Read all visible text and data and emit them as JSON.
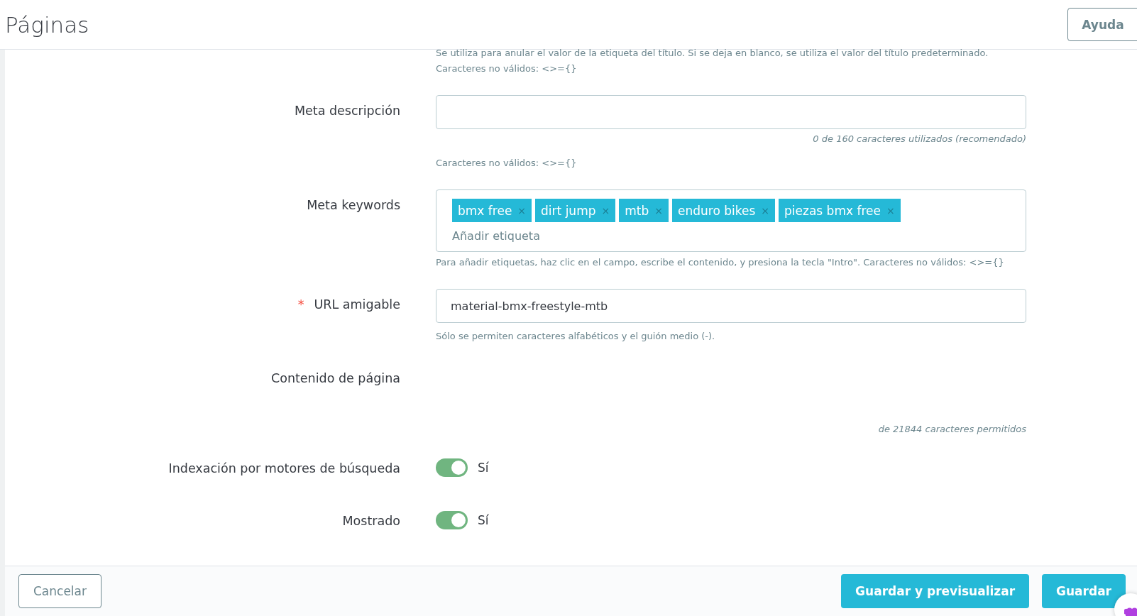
{
  "header": {
    "title": "Páginas",
    "help_button": "Ayuda"
  },
  "top_help": [
    "Se utiliza para anular el valor de la etiqueta del título. Si se deja en blanco, se utiliza el valor del título predeterminado.",
    "Caracteres no válidos: <>={}"
  ],
  "fields": [
    {
      "kind": "text",
      "label": "Meta descripción",
      "counter": "0 de 160 caracteres utilizados (recomendado)",
      "help": "Caracteres no válidos: <>={}"
    },
    {
      "kind": "tags",
      "label": "Meta keywords",
      "tags": [
        "bmx free",
        "dirt jump",
        "mtb",
        "enduro bikes",
        "piezas bmx free"
      ],
      "tag_remove": "×",
      "placeholder": "Añadir etiqueta",
      "help": "Para añadir etiquetas, haz clic en el campo, escribe el contenido, y presiona la tecla \"Intro\". Caracteres no válidos: <>={}"
    },
    {
      "kind": "text",
      "label": "URL amigable",
      "required_mark": "*",
      "value": "material-bmx-freestyle-mtb",
      "help": "Sólo se permiten caracteres alfabéticos y el guión medio (-)."
    },
    {
      "kind": "editor",
      "label": "Contenido de página",
      "counter": "de 21844 caracteres permitidos"
    },
    {
      "kind": "switch",
      "label": "Indexación por motores de búsqueda",
      "on": true,
      "state_label": "Sí"
    },
    {
      "kind": "switch",
      "label": "Mostrado",
      "on": true,
      "state_label": "Sí"
    }
  ],
  "footer": {
    "cancel": "Cancelar",
    "save_preview": "Guardar y previsualizar",
    "save": "Guardar"
  }
}
